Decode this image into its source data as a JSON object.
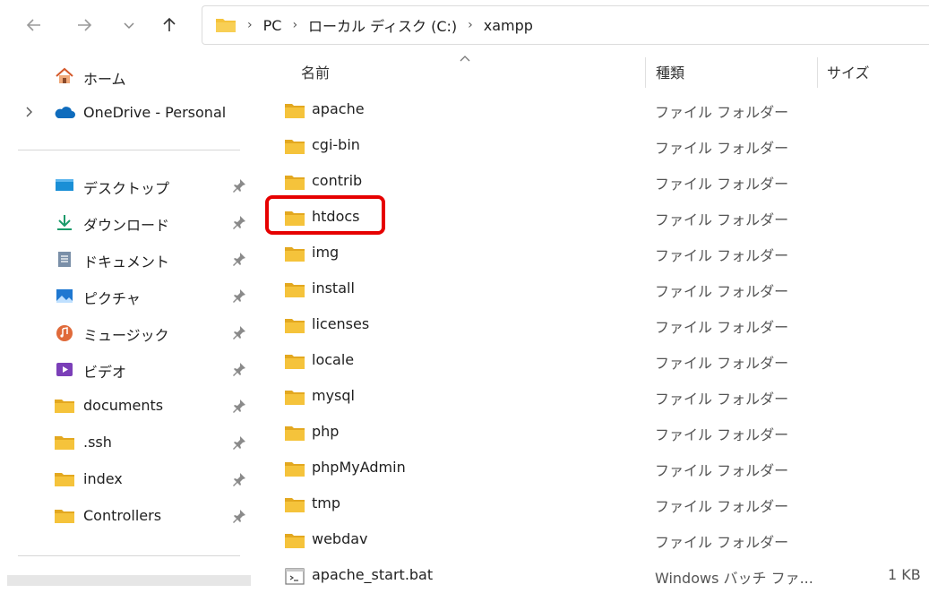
{
  "nav": {
    "back": "back-arrow-icon",
    "forward": "forward-arrow-icon",
    "recent": "chevron-down-icon",
    "up": "up-arrow-icon"
  },
  "breadcrumb": [
    "PC",
    "ローカル ディスク (C:)",
    "xampp"
  ],
  "sidebar": {
    "home": "ホーム",
    "onedrive": "OneDrive - Personal",
    "pinned": [
      {
        "label": "デスクトップ",
        "icon": "desktop-icon"
      },
      {
        "label": "ダウンロード",
        "icon": "download-icon"
      },
      {
        "label": "ドキュメント",
        "icon": "document-icon"
      },
      {
        "label": "ピクチャ",
        "icon": "pictures-icon"
      },
      {
        "label": "ミュージック",
        "icon": "music-icon"
      },
      {
        "label": "ビデオ",
        "icon": "video-icon"
      },
      {
        "label": "documents",
        "icon": "folder-icon"
      },
      {
        "label": ".ssh",
        "icon": "folder-icon"
      },
      {
        "label": "index",
        "icon": "folder-icon"
      },
      {
        "label": "Controllers",
        "icon": "folder-icon"
      }
    ]
  },
  "columns": {
    "name": "名前",
    "type": "種類",
    "size": "サイズ"
  },
  "files": [
    {
      "name": "apache",
      "type": "ファイル フォルダー",
      "size": "",
      "kind": "folder"
    },
    {
      "name": "cgi-bin",
      "type": "ファイル フォルダー",
      "size": "",
      "kind": "folder"
    },
    {
      "name": "contrib",
      "type": "ファイル フォルダー",
      "size": "",
      "kind": "folder"
    },
    {
      "name": "htdocs",
      "type": "ファイル フォルダー",
      "size": "",
      "kind": "folder"
    },
    {
      "name": "img",
      "type": "ファイル フォルダー",
      "size": "",
      "kind": "folder"
    },
    {
      "name": "install",
      "type": "ファイル フォルダー",
      "size": "",
      "kind": "folder"
    },
    {
      "name": "licenses",
      "type": "ファイル フォルダー",
      "size": "",
      "kind": "folder"
    },
    {
      "name": "locale",
      "type": "ファイル フォルダー",
      "size": "",
      "kind": "folder"
    },
    {
      "name": "mysql",
      "type": "ファイル フォルダー",
      "size": "",
      "kind": "folder"
    },
    {
      "name": "php",
      "type": "ファイル フォルダー",
      "size": "",
      "kind": "folder"
    },
    {
      "name": "phpMyAdmin",
      "type": "ファイル フォルダー",
      "size": "",
      "kind": "folder"
    },
    {
      "name": "tmp",
      "type": "ファイル フォルダー",
      "size": "",
      "kind": "folder"
    },
    {
      "name": "webdav",
      "type": "ファイル フォルダー",
      "size": "",
      "kind": "folder"
    },
    {
      "name": "apache_start.bat",
      "type": "Windows バッチ ファ...",
      "size": "1 KB",
      "kind": "batch"
    }
  ],
  "highlighted_item": "htdocs",
  "colors": {
    "folder": "#f5c33b",
    "folder_dark": "#e3a820",
    "highlight": "#e60000",
    "onedrive": "#0f6cbd"
  }
}
